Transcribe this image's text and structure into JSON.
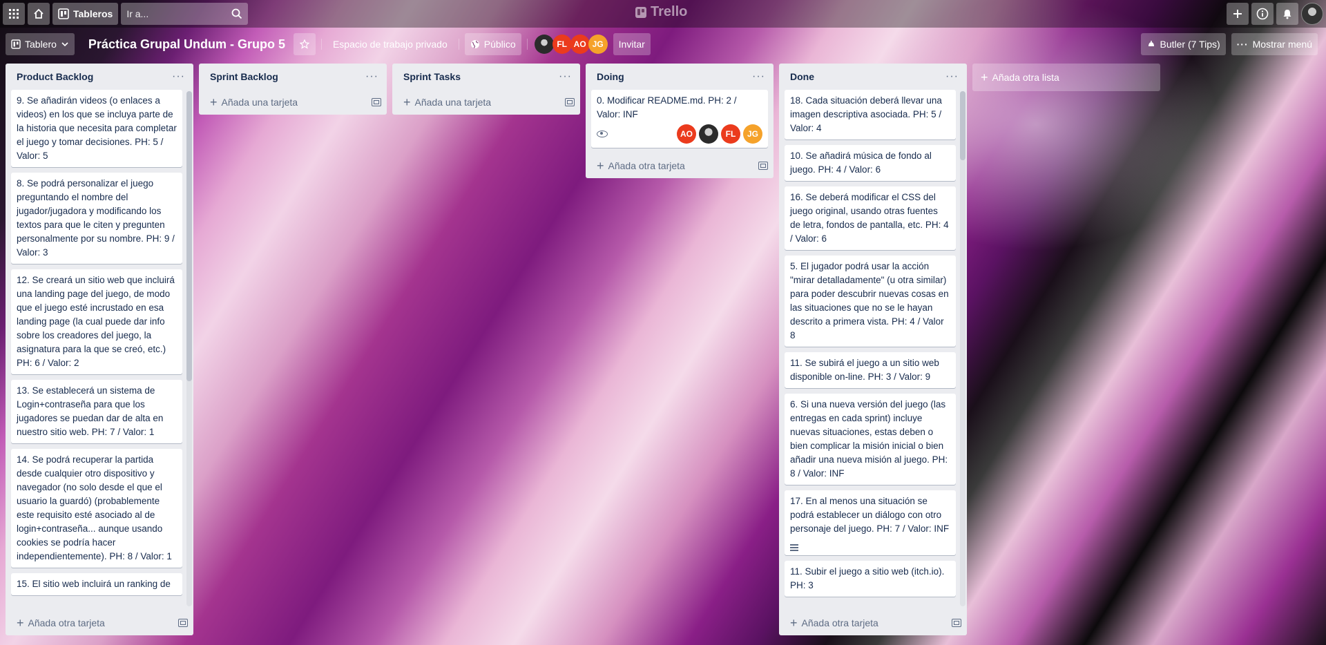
{
  "header": {
    "boards_label": "Tableros",
    "search_placeholder": "Ir a...",
    "logo_text": "Trello"
  },
  "board": {
    "view_label": "Tablero",
    "title": "Práctica Grupal Undum - Grupo 5",
    "workspace": "Espacio de trabajo privado",
    "visibility": "Público",
    "members": [
      {
        "initials": "",
        "color": "#3b3b3b"
      },
      {
        "initials": "FL",
        "color": "#eb3b1d"
      },
      {
        "initials": "AO",
        "color": "#eb3b1d"
      },
      {
        "initials": "JG",
        "color": "#f5a22a"
      }
    ],
    "invite_label": "Invitar",
    "butler_label": "Butler (7 Tips)",
    "menu_label": "Mostrar menú"
  },
  "lists": [
    {
      "title": "Product Backlog",
      "add_label": "Añada otra tarjeta",
      "cards": [
        {
          "text": "9. Se añadirán videos (o enlaces a videos) en los que se incluya parte de la historia que necesita para completar el juego y tomar decisiones. PH: 5 / Valor: 5"
        },
        {
          "text": "8. Se podrá personalizar el juego preguntando el nombre del jugador/jugadora y modificando los textos para que le citen y pregunten personalmente por su nombre. PH: 9 / Valor: 3"
        },
        {
          "text": "12. Se creará un sitio web que incluirá una landing page del juego, de modo que el juego esté incrustado en esa landing page (la cual puede dar info sobre los creadores del juego, la asignatura para la que se creó, etc.) PH: 6 / Valor: 2"
        },
        {
          "text": "13. Se establecerá un sistema de Login+contraseña para que los jugadores se puedan dar de alta en nuestro sitio web. PH: 7 / Valor: 1"
        },
        {
          "text": "14. Se podrá recuperar la partida desde cualquier otro dispositivo y navegador (no solo desde el que el usuario la guardó) (probablemente este requisito esté asociado al de login+contraseña... aunque usando cookies se podría hacer independientemente). PH: 8 / Valor: 1"
        },
        {
          "text": "15. El sitio web incluirá un ranking de"
        }
      ]
    },
    {
      "title": "Sprint Backlog",
      "add_label": "Añada una tarjeta",
      "cards": []
    },
    {
      "title": "Sprint Tasks",
      "add_label": "Añada una tarjeta",
      "cards": []
    },
    {
      "title": "Doing",
      "add_label": "Añada otra tarjeta",
      "cards": [
        {
          "text": "0. Modificar README.md. PH: 2 / Valor: INF",
          "members": [
            {
              "initials": "AO",
              "color": "#eb3b1d"
            },
            {
              "initials": "",
              "color": "#3b3b3b"
            },
            {
              "initials": "FL",
              "color": "#eb3b1d"
            },
            {
              "initials": "JG",
              "color": "#f5a22a"
            }
          ]
        }
      ]
    },
    {
      "title": "Done",
      "add_label": "Añada otra tarjeta",
      "cards": [
        {
          "text": "18. Cada situación deberá llevar una imagen descriptiva asociada. PH: 5 / Valor: 4"
        },
        {
          "text": "10. Se añadirá música de fondo al juego. PH: 4 / Valor: 6"
        },
        {
          "text": "16. Se deberá modificar el CSS del juego original, usando otras fuentes de letra, fondos de pantalla, etc. PH: 4 / Valor: 6"
        },
        {
          "text": "5. El jugador podrá usar la acción \"mirar detalladamente\" (u otra similar) para poder descubrir nuevas cosas en las situaciones que no se le hayan descrito a primera vista. PH: 4 / Valor 8"
        },
        {
          "text": "11. Se subirá el juego a un sitio web disponible on-line. PH: 3 / Valor: 9"
        },
        {
          "text": "6. Si una nueva versión del juego (las entregas en cada sprint) incluye nuevas situaciones, estas deben o bien complicar la misión inicial o bien añadir una nueva misión al juego. PH: 8 / Valor: INF"
        },
        {
          "text": "17. En al menos una situación se podrá establecer un diálogo con otro personaje del juego. PH: 7 / Valor: INF",
          "has_description": true
        },
        {
          "text": "11. Subir el juego a sitio web (itch.io). PH: 3"
        }
      ]
    }
  ],
  "add_list_label": "Añada otra lista"
}
